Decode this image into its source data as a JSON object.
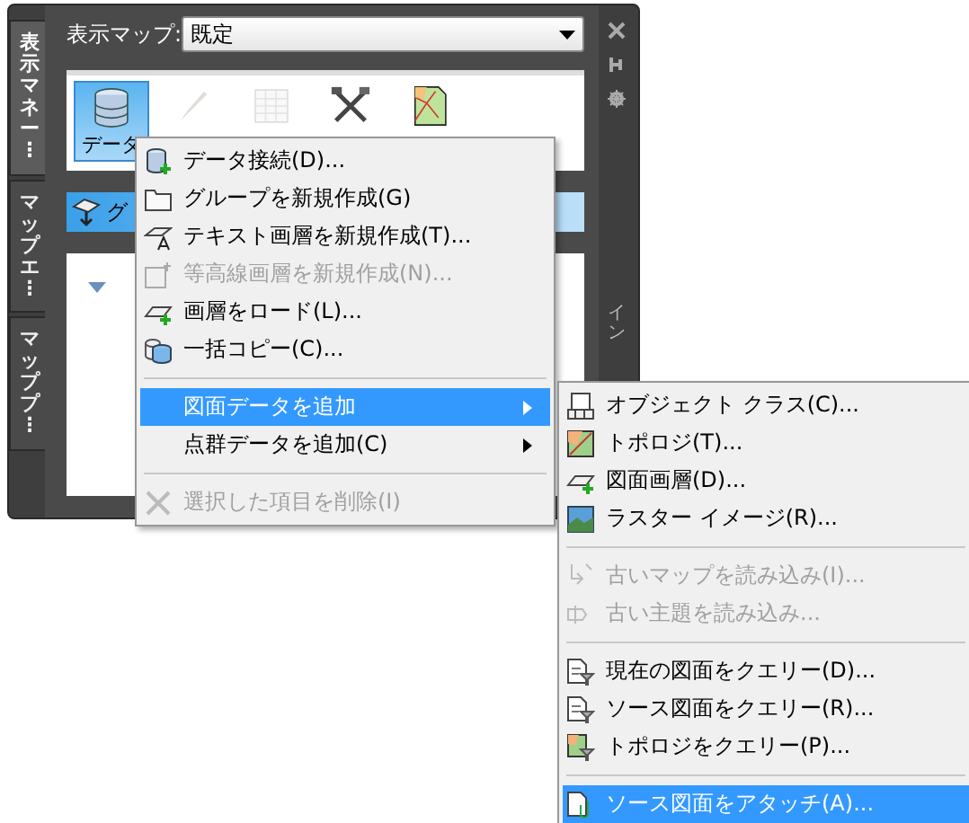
{
  "side_tabs": [
    {
      "label": "表示マネー⋮",
      "selected": true
    },
    {
      "label": "マップエ⋮",
      "selected": false
    },
    {
      "label": "マッププ⋮",
      "selected": false
    }
  ],
  "display_map": {
    "label": "表示マップ:",
    "value": "既定"
  },
  "toolbar": [
    {
      "label": "データ",
      "selected": true,
      "disabled": false
    },
    {
      "selected": false,
      "disabled": true
    },
    {
      "selected": false,
      "disabled": true
    },
    {
      "selected": false,
      "disabled": false
    },
    {
      "selected": false,
      "disabled": false
    }
  ],
  "group_bar": {
    "label": "グ"
  },
  "right_strip": {
    "title": "イン"
  },
  "context_menu": [
    {
      "kind": "item",
      "label": "データ接続(D)...",
      "disabled": false,
      "selected": false,
      "submenu": false
    },
    {
      "kind": "item",
      "label": "グループを新規作成(G)",
      "disabled": false,
      "selected": false,
      "submenu": false
    },
    {
      "kind": "item",
      "label": "テキスト画層を新規作成(T)...",
      "disabled": false,
      "selected": false,
      "submenu": false
    },
    {
      "kind": "item",
      "label": "等高線画層を新規作成(N)...",
      "disabled": true,
      "selected": false,
      "submenu": false
    },
    {
      "kind": "item",
      "label": "画層をロード(L)...",
      "disabled": false,
      "selected": false,
      "submenu": false
    },
    {
      "kind": "item",
      "label": "一括コピー(C)...",
      "disabled": false,
      "selected": false,
      "submenu": false
    },
    {
      "kind": "separator"
    },
    {
      "kind": "item",
      "label": "図面データを追加",
      "disabled": false,
      "selected": true,
      "submenu": true
    },
    {
      "kind": "item",
      "label": "点群データを追加(C)",
      "disabled": false,
      "selected": false,
      "submenu": true
    },
    {
      "kind": "separator"
    },
    {
      "kind": "item",
      "label": "選択した項目を削除(I)",
      "disabled": true,
      "selected": false,
      "submenu": false
    }
  ],
  "submenu": [
    {
      "kind": "item",
      "label": "オブジェクト クラス(C)...",
      "disabled": false,
      "selected": false
    },
    {
      "kind": "item",
      "label": "トポロジ(T)...",
      "disabled": false,
      "selected": false
    },
    {
      "kind": "item",
      "label": "図面画層(D)...",
      "disabled": false,
      "selected": false
    },
    {
      "kind": "item",
      "label": "ラスター イメージ(R)...",
      "disabled": false,
      "selected": false
    },
    {
      "kind": "separator"
    },
    {
      "kind": "item",
      "label": "古いマップを読み込み(I)...",
      "disabled": true,
      "selected": false
    },
    {
      "kind": "item",
      "label": "古い主題を読み込み...",
      "disabled": true,
      "selected": false
    },
    {
      "kind": "separator"
    },
    {
      "kind": "item",
      "label": "現在の図面をクエリー(D)...",
      "disabled": false,
      "selected": false
    },
    {
      "kind": "item",
      "label": "ソース図面をクエリー(R)...",
      "disabled": false,
      "selected": false
    },
    {
      "kind": "item",
      "label": "トポロジをクエリー(P)...",
      "disabled": false,
      "selected": false
    },
    {
      "kind": "separator"
    },
    {
      "kind": "item",
      "label": "ソース図面をアタッチ(A)...",
      "disabled": false,
      "selected": true
    }
  ]
}
